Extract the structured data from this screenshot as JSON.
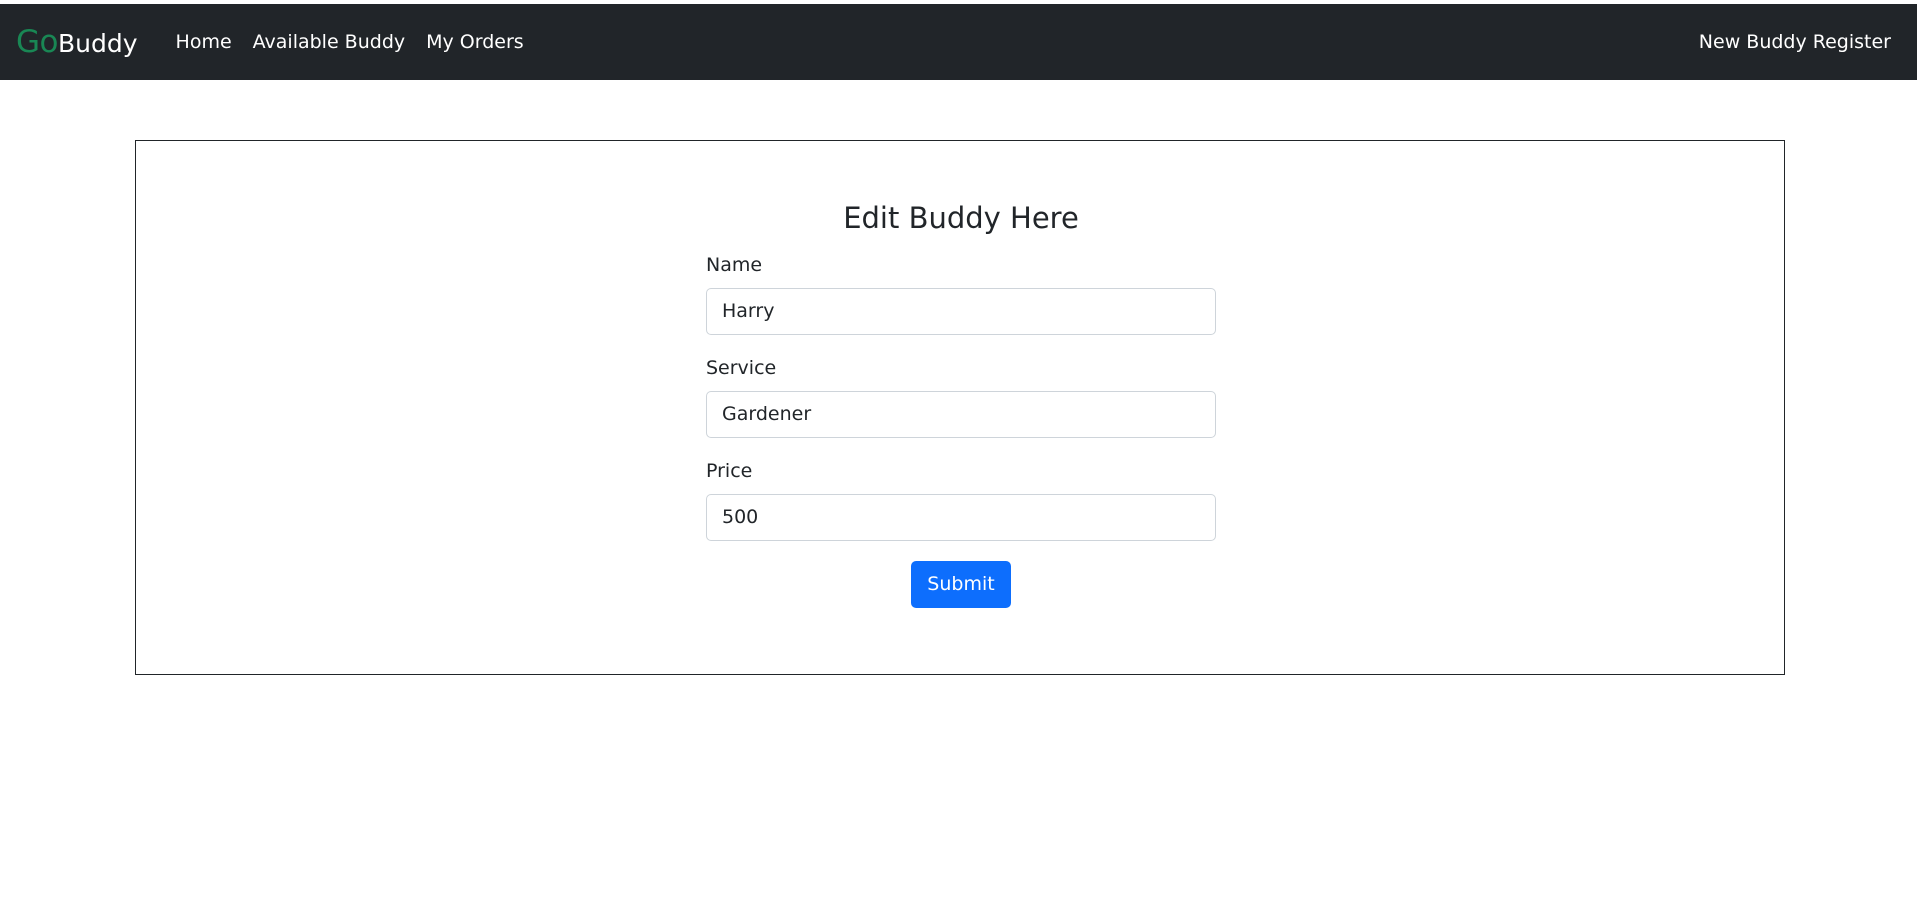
{
  "navbar": {
    "brand": {
      "part1": "Go",
      "part2": "Buddy"
    },
    "links": [
      {
        "label": "Home"
      },
      {
        "label": "Available Buddy"
      },
      {
        "label": "My Orders"
      }
    ],
    "right_link": "New Buddy Register"
  },
  "form": {
    "title": "Edit Buddy Here",
    "fields": [
      {
        "label": "Name",
        "value": "Harry"
      },
      {
        "label": "Service",
        "value": "Gardener"
      },
      {
        "label": "Price",
        "value": "500"
      }
    ],
    "submit_label": "Submit"
  },
  "colors": {
    "navbar_bg": "#212529",
    "brand_accent": "#198754",
    "primary_button": "#0d6efd"
  }
}
